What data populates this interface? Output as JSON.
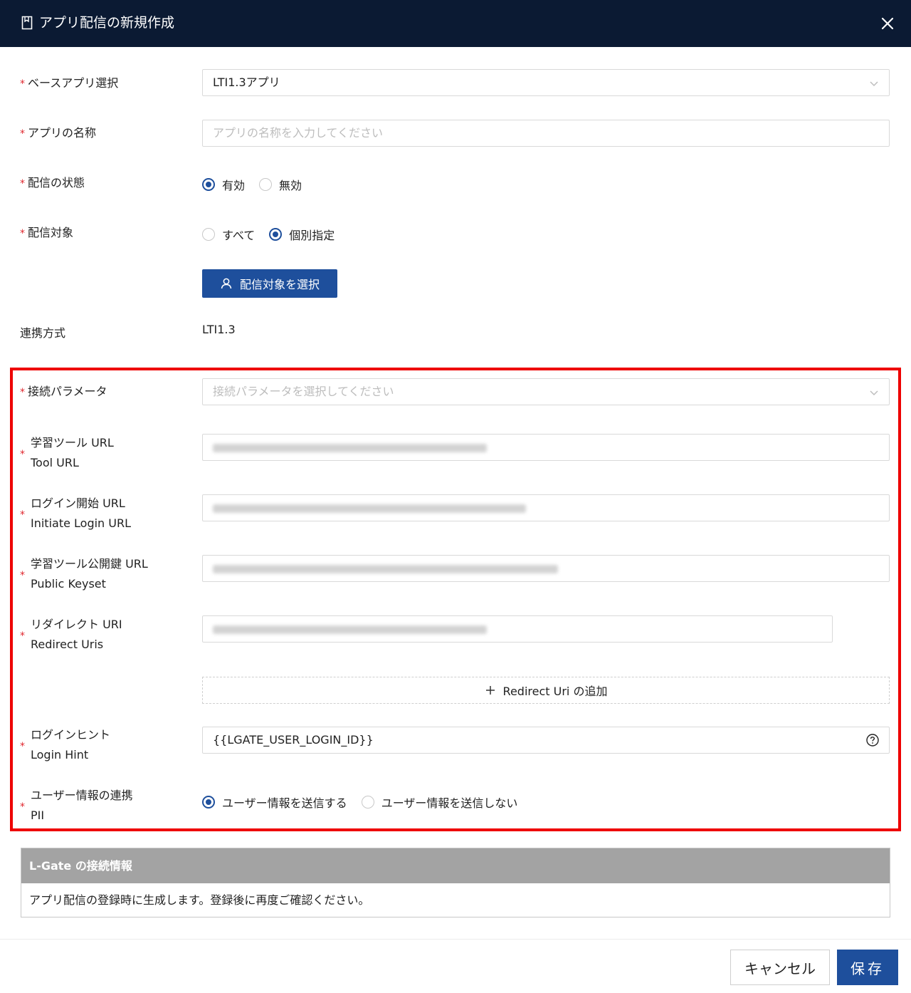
{
  "dialog": {
    "title": "アプリ配信の新規作成"
  },
  "form": {
    "base_app": {
      "label": "ベースアプリ選択",
      "value": "LTI1.3アプリ"
    },
    "app_name": {
      "label": "アプリの名称",
      "placeholder": "アプリの名称を入力してください"
    },
    "status": {
      "label": "配信の状態",
      "options": [
        "有効",
        "無効"
      ],
      "selected": "有効"
    },
    "target": {
      "label": "配信対象",
      "options": [
        "すべて",
        "個別指定"
      ],
      "selected": "個別指定",
      "select_button": "配信対象を選択"
    },
    "link_method": {
      "label": "連携方式",
      "value": "LTI1.3"
    },
    "conn_param": {
      "label": "接続パラメータ",
      "placeholder": "接続パラメータを選択してください"
    },
    "tool_url": {
      "label_ja": "学習ツール URL",
      "label_en": "Tool URL"
    },
    "login_url": {
      "label_ja": "ログイン開始 URL",
      "label_en": "Initiate Login URL"
    },
    "keyset": {
      "label_ja": "学習ツール公開鍵 URL",
      "label_en": "Public Keyset"
    },
    "redirect": {
      "label_ja": "リダイレクト URI",
      "label_en": "Redirect Uris",
      "add_button": "Redirect Uri の追加"
    },
    "login_hint": {
      "label_ja": "ログインヒント",
      "label_en": "Login Hint",
      "value": "{{LGATE_USER_LOGIN_ID}}"
    },
    "pii": {
      "label_ja": "ユーザー情報の連携",
      "label_en": "PII",
      "options": [
        "ユーザー情報を送信する",
        "ユーザー情報を送信しない"
      ],
      "selected": "ユーザー情報を送信する"
    }
  },
  "info": {
    "title": "L-Gate の接続情報",
    "body": "アプリ配信の登録時に生成します。登録後に再度ご確認ください。"
  },
  "footer": {
    "cancel": "キャンセル",
    "save": "保存"
  },
  "colors": {
    "header_bg": "#0b1a33",
    "primary": "#1e4f9c",
    "required": "#e0282e",
    "highlight": "#ee0000"
  }
}
